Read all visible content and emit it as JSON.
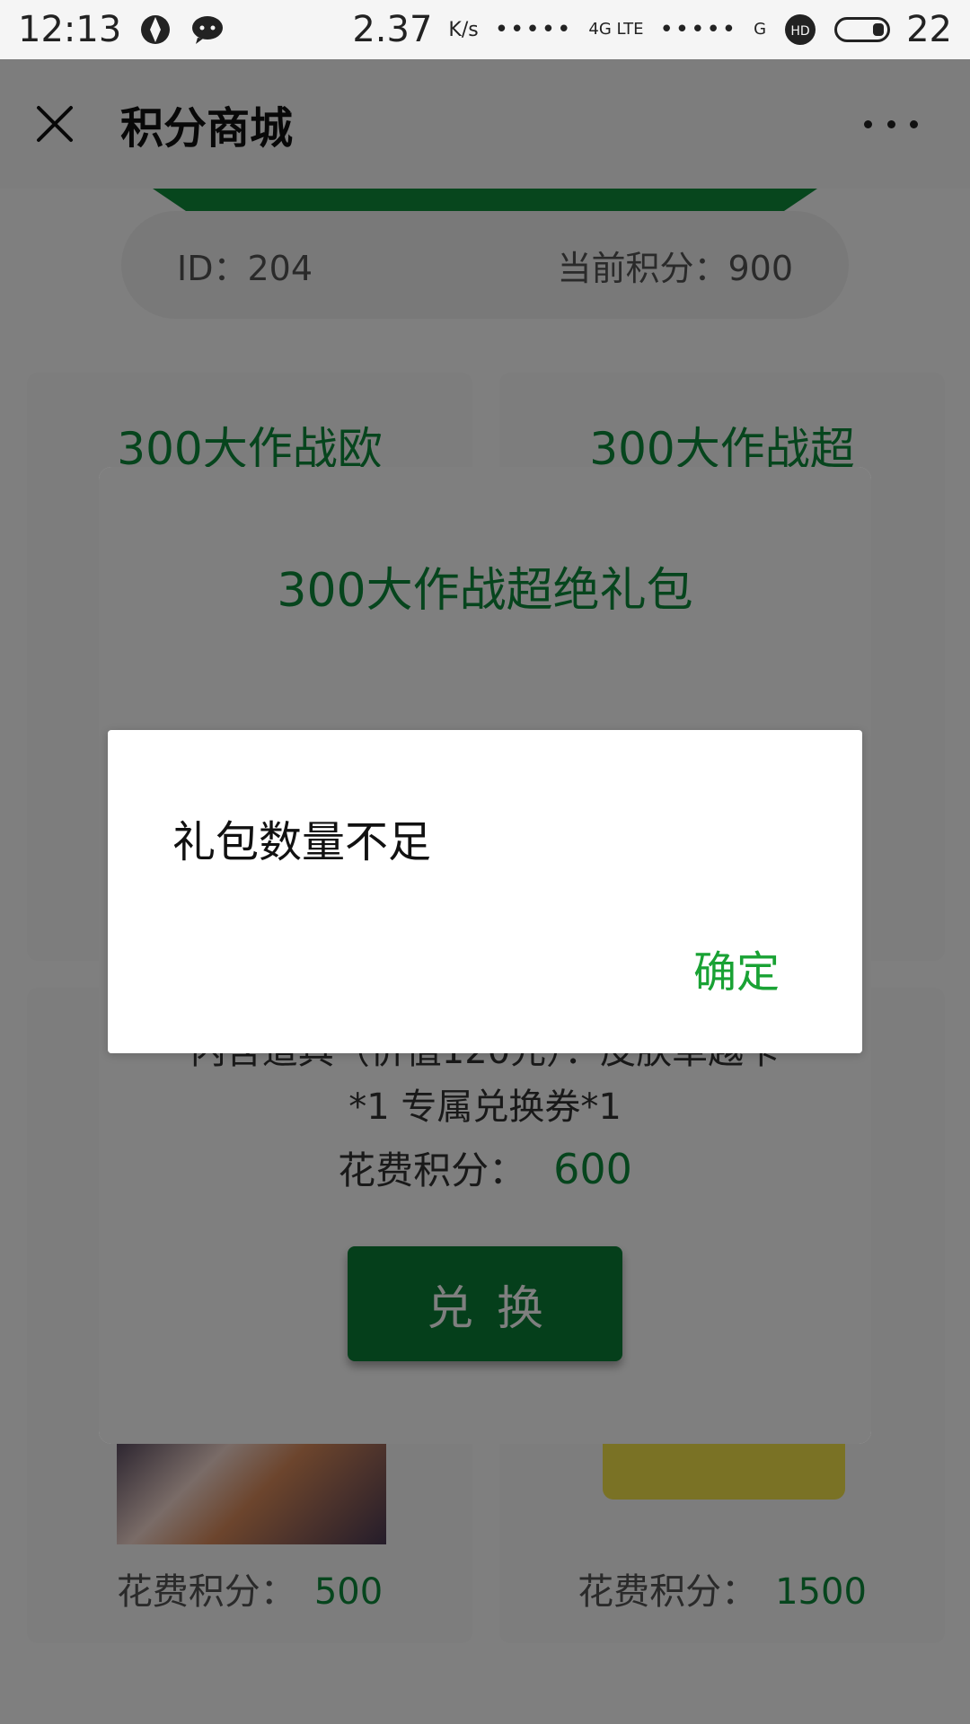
{
  "status_bar": {
    "time": "12:13",
    "speed": "2.37",
    "speed_unit": "K/s",
    "network": "4G LTE",
    "signal_dots": "•••••",
    "signal_dots_2": "•••••",
    "g_label": "G",
    "hd_label": "HD",
    "battery": "22"
  },
  "title_bar": {
    "title": "积分商城"
  },
  "account": {
    "id_text": "ID：204",
    "points_text": "当前积分：900"
  },
  "cards": [
    {
      "title": "300大作战欧"
    },
    {
      "title": "300大作战超"
    },
    {
      "cost_label": "花费积分：",
      "cost_value": "500"
    },
    {
      "cost_label": "花费积分：",
      "cost_value": "1500"
    }
  ],
  "gift_modal": {
    "title": "300大作战超绝礼包",
    "desc_line1": "内含道具（价值120元）：皮肤卓越卡",
    "desc_line2": "*1 专属兑换券*1",
    "cost_label": "花费积分：",
    "cost_value": "600",
    "redeem_label": "兑换"
  },
  "alert": {
    "message": "礼包数量不足",
    "ok_label": "确定"
  },
  "colors": {
    "accent_green": "#0d8a3b",
    "ok_green": "#19a234"
  }
}
